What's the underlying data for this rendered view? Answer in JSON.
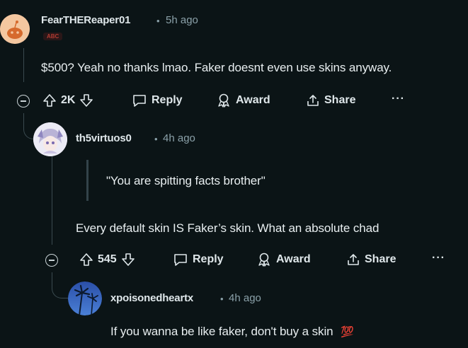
{
  "comments": [
    {
      "username": "FearTHEReaper01",
      "separator": "•",
      "time": "5h ago",
      "flair": "ABC",
      "body": "$500? Yeah no thanks lmao. Faker doesnt even use skins anyway.",
      "actions": {
        "votes": "2K",
        "reply": "Reply",
        "award": "Award",
        "share": "Share",
        "more": "···"
      }
    },
    {
      "username": "th5virtuos0",
      "separator": "•",
      "time": "4h ago",
      "quote": "\"You are spitting facts brother\"",
      "body": "Every default skin IS Faker’s skin. What an absolute chad",
      "actions": {
        "votes": "545",
        "reply": "Reply",
        "award": "Award",
        "share": "Share",
        "more": "···"
      }
    },
    {
      "username": "xpoisonedheartx",
      "separator": "•",
      "time": "4h ago",
      "body": "If you wanna be like faker, don't buy a skin",
      "emoji": "💯"
    }
  ],
  "colors": {
    "background": "#0b1416",
    "thread_line": "#3a4a4f",
    "meta_text": "#8ba1a9"
  },
  "icons": [
    "reddit-avatar-icon",
    "anime-avatar-icon",
    "palm-tree-avatar-icon",
    "upvote-icon",
    "downvote-icon",
    "reply-icon",
    "award-icon",
    "share-icon",
    "collapse-icon"
  ]
}
